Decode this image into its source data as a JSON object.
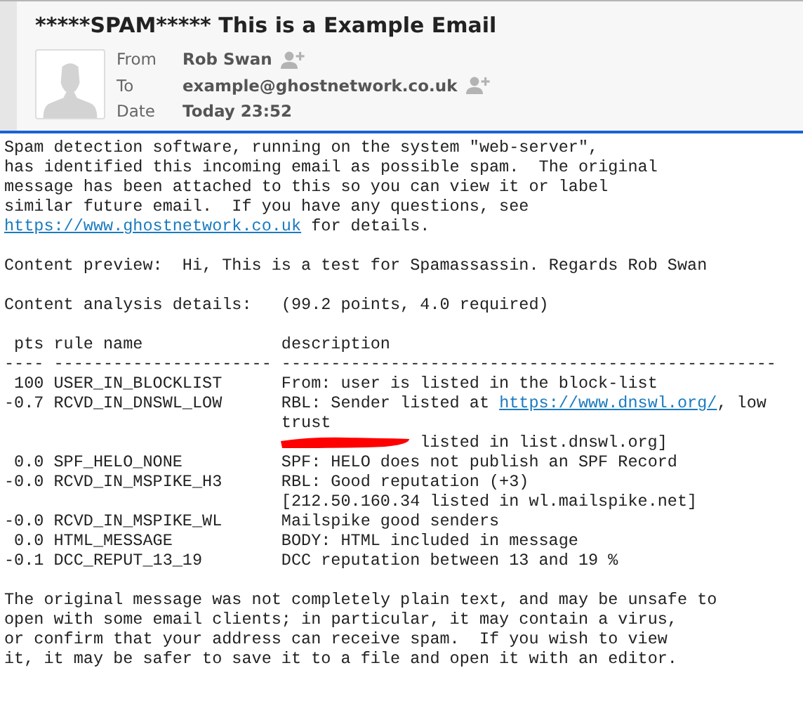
{
  "email": {
    "subject": "*****SPAM***** This is a Example Email",
    "fields": [
      {
        "label": "From",
        "value": "Rob Swan",
        "add_contact": true
      },
      {
        "label": "To",
        "value": "example@ghostnetwork.co.uk",
        "add_contact": true
      },
      {
        "label": "Date",
        "value": "Today 23:52",
        "add_contact": false
      }
    ]
  },
  "report": {
    "intro": [
      [
        {
          "kind": "text",
          "text": "Spam detection software, running on the system \"web-server\","
        }
      ],
      [
        {
          "kind": "text",
          "text": "has identified this incoming email as possible spam.  The original"
        }
      ],
      [
        {
          "kind": "text",
          "text": "message has been attached to this so you can view it or label"
        }
      ],
      [
        {
          "kind": "text",
          "text": "similar future email.  If you have any questions, see"
        }
      ],
      [
        {
          "kind": "link",
          "text": "https://www.ghostnetwork.co.uk"
        },
        {
          "kind": "text",
          "text": " for details."
        }
      ]
    ],
    "preview": "Content preview:  Hi, This is a test for Spamassassin. Regards Rob Swan",
    "analysis": "Content analysis details:   (99.2 points, 4.0 required)",
    "columns": [
      "pts",
      "rule name",
      "description"
    ],
    "dividers": [
      "----",
      "----------------------",
      "--------------------------------------------------"
    ],
    "rules": [
      {
        "pts": "100",
        "name": "USER_IN_BLOCKLIST",
        "description": [
          [
            {
              "kind": "text",
              "text": "From: user is listed in the block-list"
            }
          ]
        ]
      },
      {
        "pts": "-0.7",
        "name": "RCVD_IN_DNSWL_LOW",
        "description": [
          [
            {
              "kind": "text",
              "text": "RBL: Sender listed at "
            },
            {
              "kind": "link",
              "text": "https://www.dnswl.org/"
            },
            {
              "kind": "text",
              "text": ", low"
            }
          ],
          [
            {
              "kind": "text",
              "text": "trust"
            }
          ],
          [
            {
              "kind": "redaction"
            },
            {
              "kind": "text",
              "text": " listed in list.dnswl.org]"
            }
          ]
        ]
      },
      {
        "pts": "0.0",
        "name": "SPF_HELO_NONE",
        "description": [
          [
            {
              "kind": "text",
              "text": "SPF: HELO does not publish an SPF Record"
            }
          ]
        ]
      },
      {
        "pts": "-0.0",
        "name": "RCVD_IN_MSPIKE_H3",
        "description": [
          [
            {
              "kind": "text",
              "text": "RBL: Good reputation (+3)"
            }
          ],
          [
            {
              "kind": "text",
              "text": "[212.50.160.34 listed in wl.mailspike.net]"
            }
          ]
        ]
      },
      {
        "pts": "-0.0",
        "name": "RCVD_IN_MSPIKE_WL",
        "description": [
          [
            {
              "kind": "text",
              "text": "Mailspike good senders"
            }
          ]
        ]
      },
      {
        "pts": "0.0",
        "name": "HTML_MESSAGE",
        "description": [
          [
            {
              "kind": "text",
              "text": "BODY: HTML included in message"
            }
          ]
        ]
      },
      {
        "pts": "-0.1",
        "name": "DCC_REPUT_13_19",
        "description": [
          [
            {
              "kind": "text",
              "text": "DCC reputation between 13 and 19 %"
            }
          ]
        ]
      }
    ],
    "closing": [
      [
        {
          "kind": "text",
          "text": "The original message was not completely plain text, and may be unsafe to"
        }
      ],
      [
        {
          "kind": "text",
          "text": "open with some email clients; in particular, it may contain a virus,"
        }
      ],
      [
        {
          "kind": "text",
          "text": "or confirm that your address can receive spam.  If you wish to view"
        }
      ],
      [
        {
          "kind": "text",
          "text": "it, it may be safer to save it to a file and open it with an editor."
        }
      ]
    ]
  }
}
